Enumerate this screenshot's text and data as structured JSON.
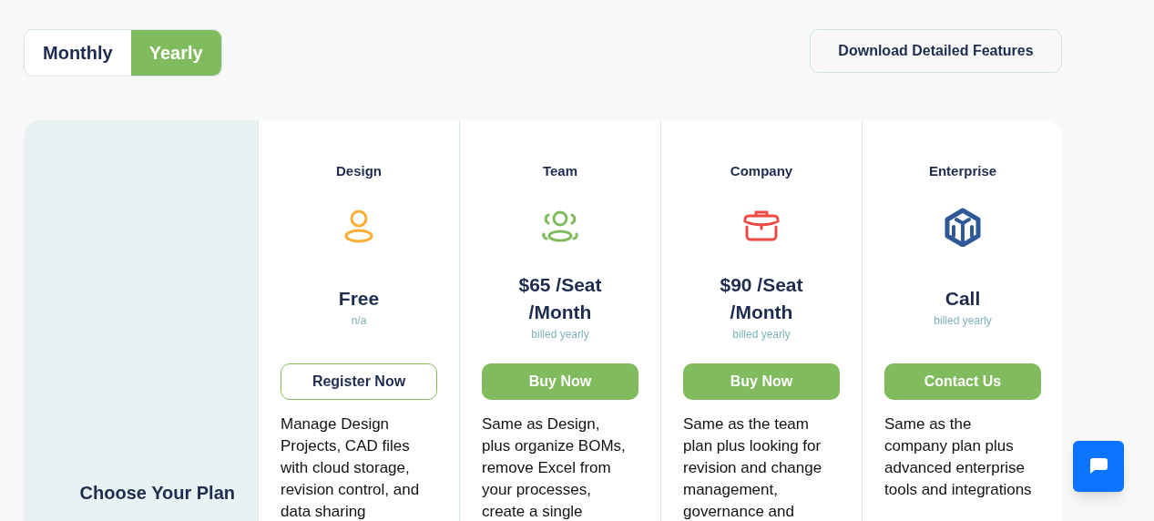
{
  "billing_toggle": [
    {
      "label": "Monthly",
      "selected": false
    },
    {
      "label": "Yearly",
      "selected": true
    }
  ],
  "download_button": "Download Detailed Features",
  "sidebar_heading": "Choose Your Plan",
  "plans": [
    {
      "name": "Design",
      "color": "#f9ae36",
      "price": "Free",
      "note": "n/a",
      "button": {
        "label": "Register Now",
        "kind": "outline"
      },
      "description": "Manage Design Projects, CAD files with cloud storage, revision control, and data sharing"
    },
    {
      "name": "Team",
      "color": "#80bb5d",
      "price": "$65 /Seat /Month",
      "note": "billed yearly",
      "button": {
        "label": "Buy Now",
        "kind": "filled"
      },
      "description": "Same as Design, plus organize BOMs, remove Excel from your processes, create a single"
    },
    {
      "name": "Company",
      "color": "#ef4a43",
      "price": "$90 /Seat /Month",
      "note": "billed yearly",
      "button": {
        "label": "Buy Now",
        "kind": "filled"
      },
      "description": "Same as the team plan plus looking for revision and change management, governance and"
    },
    {
      "name": "Enterprise",
      "color": "#2f5896",
      "price": "Call",
      "note": "billed yearly",
      "button": {
        "label": "Contact Us",
        "kind": "filled"
      },
      "description": "Same as the company plan plus advanced enterprise tools and integrations"
    }
  ]
}
